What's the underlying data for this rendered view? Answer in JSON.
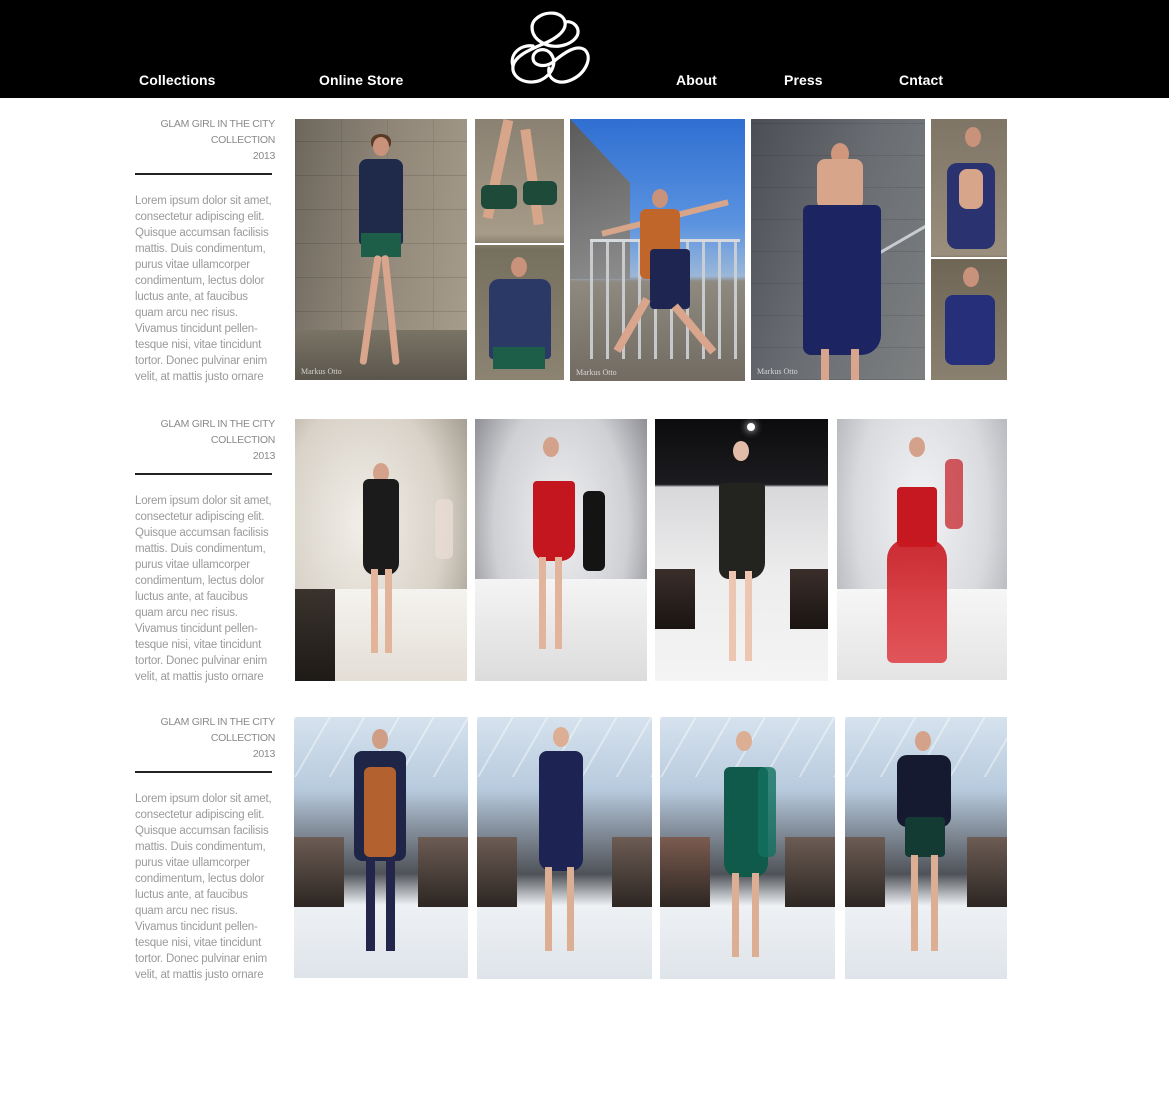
{
  "nav": {
    "collections": "Collections",
    "online_store": "Online Store",
    "about": "About",
    "press": "Press",
    "contact": "Cntact"
  },
  "collections": [
    {
      "title_line1": "GLAM GIRL IN THE CITY",
      "title_line2": "COLLECTION",
      "year": "2013",
      "description": "Lorem ipsum dolor sit amet, consectetur adipiscing elit. Quisque accumsan facilisis mattis. Duis condimentum, purus vitae ullamcorper condimentum, lectus dolor luctus ante, at faucibus quam arcu nec risus. Vivamus tincidunt pellen-tesque nisi, vitae tincidunt tortor. Donec pulvinar enim velit, at mattis justo ornare"
    },
    {
      "title_line1": "GLAM GIRL IN THE CITY",
      "title_line2": "COLLECTION",
      "year": "2013",
      "description": "Lorem ipsum dolor sit amet, consectetur adipiscing elit. Quisque accumsan facilisis mattis. Duis condimentum, purus vitae ullamcorper condimentum, lectus dolor luctus ante, at faucibus quam arcu nec risus. Vivamus tincidunt pellen-tesque nisi, vitae tincidunt tortor. Donec pulvinar enim velit, at mattis justo ornare"
    },
    {
      "title_line1": "GLAM GIRL IN THE CITY",
      "title_line2": "COLLECTION",
      "year": "2013",
      "description": "Lorem ipsum dolor sit amet, consectetur adipiscing elit. Quisque accumsan facilisis mattis. Duis condimentum, purus vitae ullamcorper condimentum, lectus dolor luctus ante, at faucibus quam arcu nec risus. Vivamus tincidunt pellen-tesque nisi, vitae tincidunt tortor. Donec pulvinar enim velit, at mattis justo ornare"
    }
  ],
  "colors": {
    "header_bg": "#000000",
    "text_gray": "#9a9a9a"
  }
}
